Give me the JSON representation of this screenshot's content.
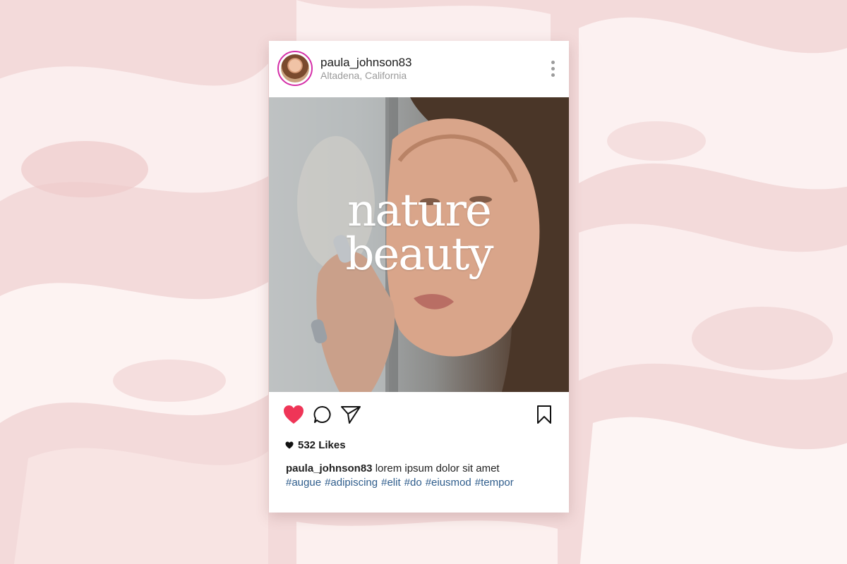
{
  "post": {
    "username": "paula_johnson83",
    "location": "Altadena, California",
    "overlay_line1": "nature",
    "overlay_line2": "beauty",
    "likes": "532 Likes",
    "caption_user": "paula_johnson83",
    "caption_text": "lorem ipsum dolor sit amet",
    "hashtags": [
      "#augue",
      "#adipiscing",
      "#elit",
      "#do",
      "#eiusmod",
      "#tempor"
    ],
    "liked": true
  },
  "icons": {
    "more": "more-vertical-icon",
    "like": "heart-icon",
    "comment": "comment-icon",
    "share": "send-icon",
    "save": "bookmark-icon"
  },
  "colors": {
    "background": "#f4dcdc",
    "card": "#ffffff",
    "liked_heart": "#ef3557",
    "avatar_ring": "#d52fa8",
    "hashtag": "#2f5d8c",
    "location": "#9a9a9a"
  }
}
